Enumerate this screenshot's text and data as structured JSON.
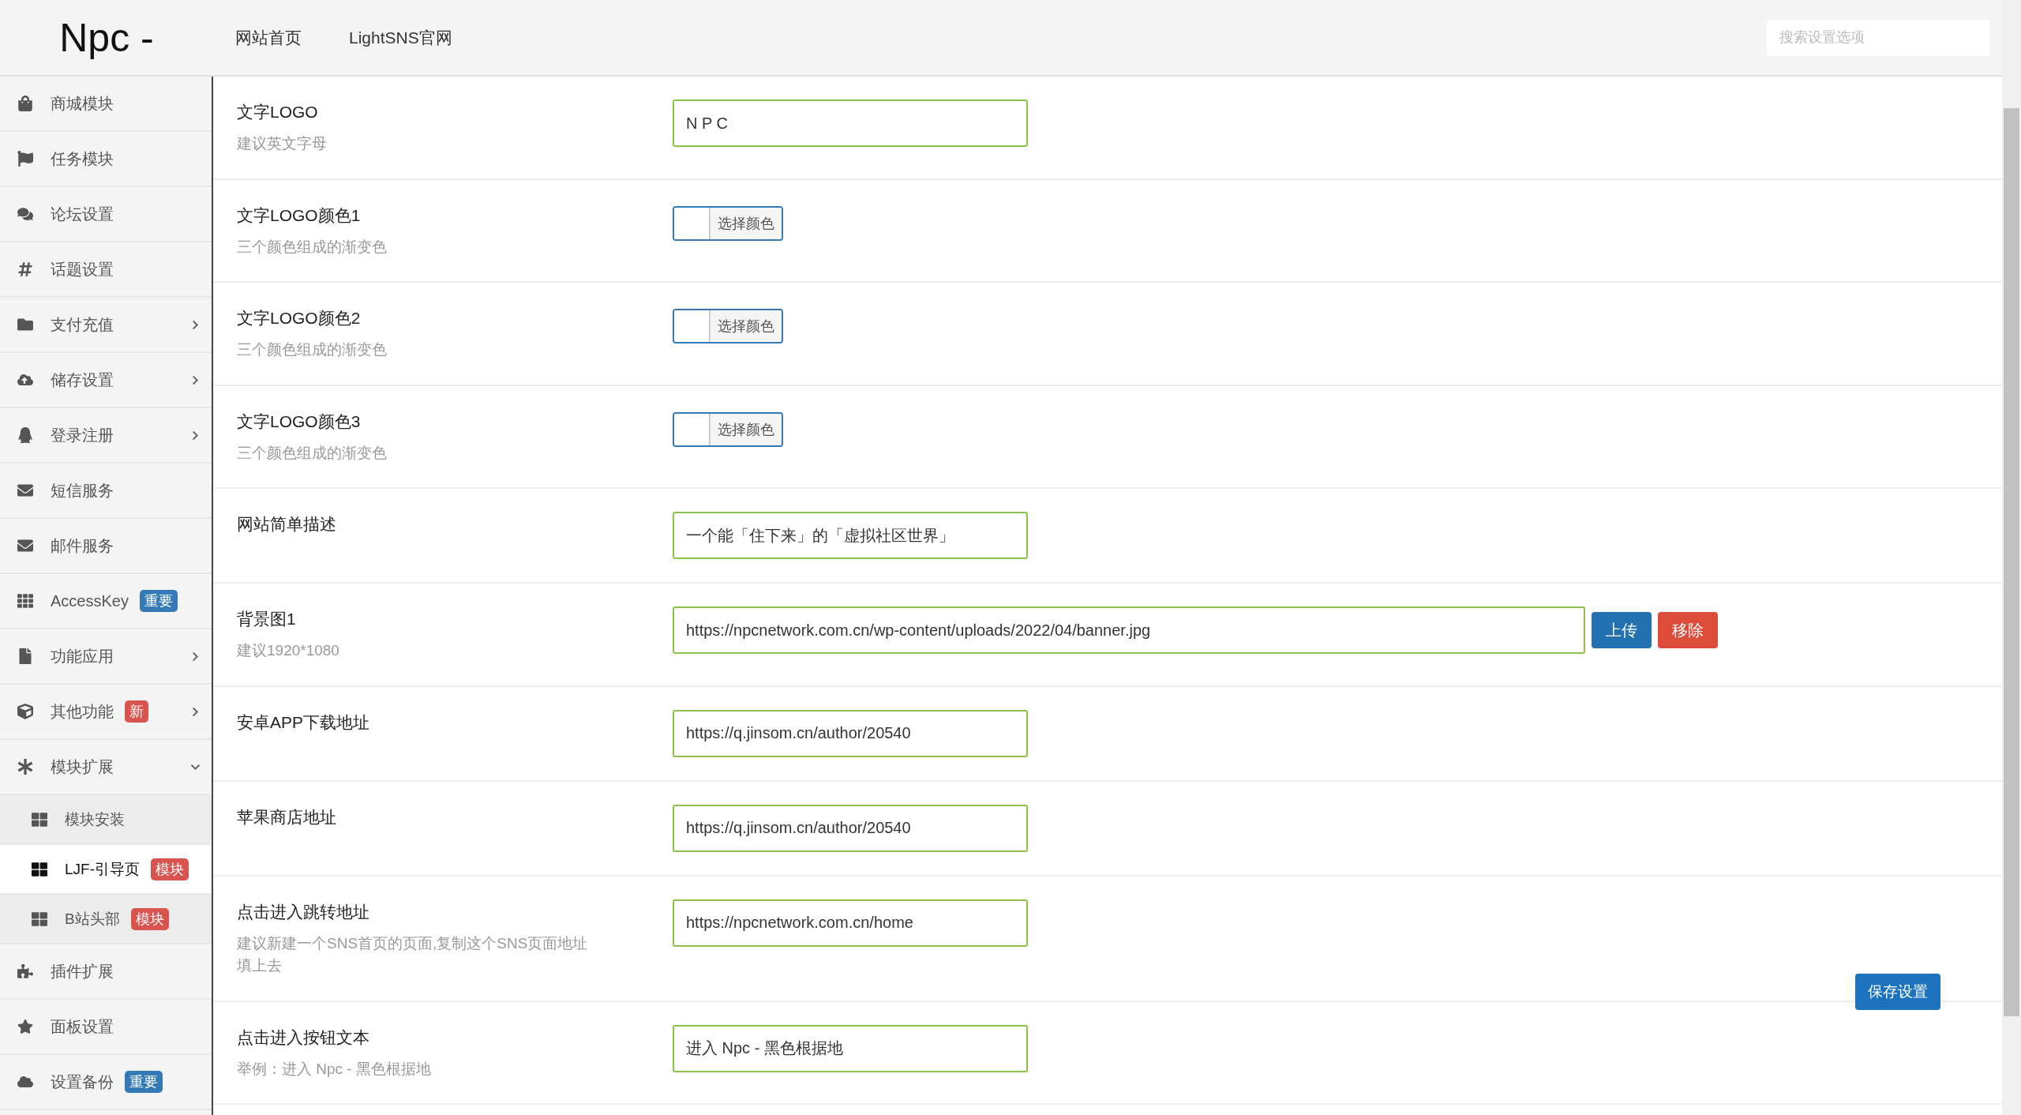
{
  "header": {
    "logo": "Npc -",
    "nav": [
      "网站首页",
      "LightSNS官网"
    ],
    "search": {
      "placeholder": "搜索设置选项"
    }
  },
  "sidebar": {
    "items": [
      {
        "label": "商城模块"
      },
      {
        "label": "任务模块"
      },
      {
        "label": "论坛设置"
      },
      {
        "label": "话题设置"
      },
      {
        "label": "支付充值",
        "expanded": false
      },
      {
        "label": "储存设置",
        "expanded": false
      },
      {
        "label": "登录注册",
        "expanded": false
      },
      {
        "label": "短信服务"
      },
      {
        "label": "邮件服务"
      },
      {
        "label": "AccessKey",
        "badge": {
          "text": "重要",
          "color": "#337ab7"
        }
      },
      {
        "label": "功能应用",
        "expanded": false
      },
      {
        "label": "其他功能",
        "badge": {
          "text": "新",
          "color": "#d9534f"
        },
        "expanded": false
      },
      {
        "label": "模块扩展",
        "expanded": true,
        "children": [
          {
            "label": "模块安装",
            "selected": false
          },
          {
            "label": "LJF-引导页",
            "badge": {
              "text": "模块",
              "color": "#d9534f"
            },
            "selected": true
          },
          {
            "label": "B站头部",
            "badge": {
              "text": "模块",
              "color": "#d9534f"
            },
            "selected": false
          }
        ]
      },
      {
        "label": "插件扩展"
      },
      {
        "label": "面板设置"
      },
      {
        "label": "设置备份",
        "badge": {
          "text": "重要",
          "color": "#337ab7"
        }
      }
    ]
  },
  "settings": [
    {
      "kind": "text",
      "label": "文字LOGO",
      "hint": "建议英文字母",
      "value": "N P C"
    },
    {
      "kind": "color",
      "label": "文字LOGO颜色1",
      "hint": "三个颜色组成的渐变色",
      "button": "选择颜色"
    },
    {
      "kind": "color",
      "label": "文字LOGO颜色2",
      "hint": "三个颜色组成的渐变色",
      "button": "选择颜色"
    },
    {
      "kind": "color",
      "label": "文字LOGO颜色3",
      "hint": "三个颜色组成的渐变色",
      "button": "选择颜色"
    },
    {
      "kind": "text",
      "label": "网站简单描述",
      "value": "一个能「住下来」的「虚拟社区世界」"
    },
    {
      "kind": "upload",
      "label": "背景图1",
      "hint": "建议1920*1080",
      "value": "https://npcnetwork.com.cn/wp-content/uploads/2022/04/banner.jpg",
      "upload": "上传",
      "remove": "移除"
    },
    {
      "kind": "text",
      "label": "安卓APP下载地址",
      "value": "https://q.jinsom.cn/author/20540"
    },
    {
      "kind": "text",
      "label": "苹果商店地址",
      "value": "https://q.jinsom.cn/author/20540"
    },
    {
      "kind": "text",
      "label": "点击进入跳转地址",
      "hint": "建议新建一个SNS首页的页面,复制这个SNS页面地址填上去",
      "value": "https://npcnetwork.com.cn/home"
    },
    {
      "kind": "text",
      "label": "点击进入按钮文本",
      "hint": "举例：进入 Npc - 黑色根据地",
      "value": "进入 Npc - 黑色根据地"
    }
  ],
  "save_button": "保存设置"
}
